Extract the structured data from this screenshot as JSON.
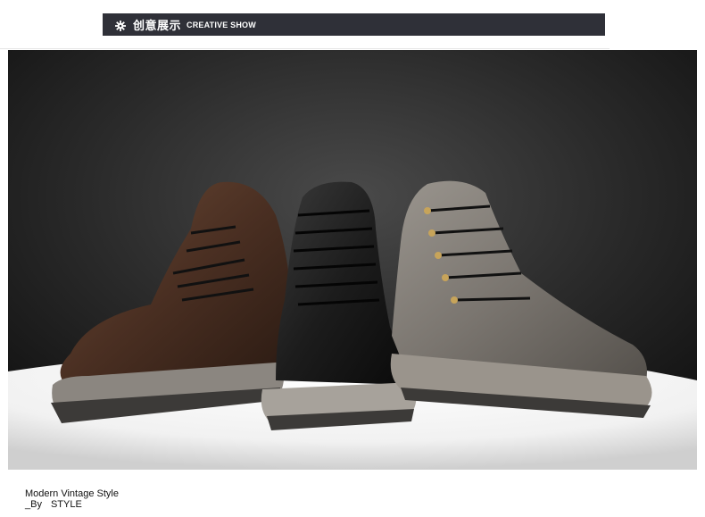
{
  "banner": {
    "icon": "gear-icon",
    "title_cn": "创意展示",
    "title_en": "CREATIVE SHOW",
    "background": "#2f3038"
  },
  "photo": {
    "subject": "boots-photo"
  },
  "caption": {
    "line1": "Modern Vintage Style",
    "line2_prefix": "_By",
    "line2_word": "STYLE"
  }
}
